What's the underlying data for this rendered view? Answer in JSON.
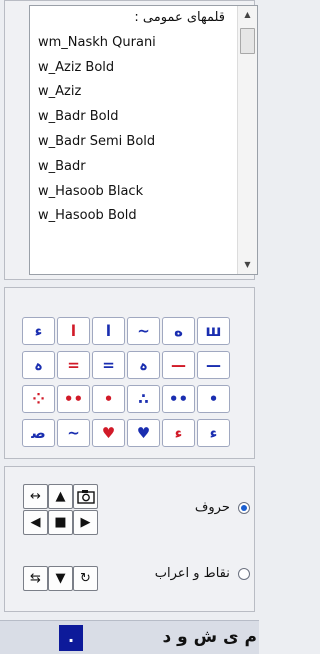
{
  "font_list": {
    "items": [
      "قلمهای عمومی :",
      "wm_Naskh Qurani",
      "w_Aziz Bold",
      "w_Aziz",
      "w_Badr Bold",
      "w_Badr Semi Bold",
      "w_Badr",
      "w_Hasoob Black",
      "w_Hasoob Bold"
    ],
    "scroll_up_icon": "triangle-up",
    "scroll_down_icon": "triangle-down"
  },
  "symbols": [
    {
      "glyph": "ء",
      "color": "#1a2eb0"
    },
    {
      "glyph": "ا",
      "color": "#d11a28"
    },
    {
      "glyph": "ا",
      "color": "#1a2eb0"
    },
    {
      "glyph": "~",
      "color": "#1a2eb0"
    },
    {
      "glyph": "ه",
      "color": "#1a2eb0"
    },
    {
      "glyph": "ш",
      "color": "#1a2eb0"
    },
    {
      "glyph": "ہ",
      "color": "#1a2eb0"
    },
    {
      "glyph": "=",
      "color": "#d11a28"
    },
    {
      "glyph": "=",
      "color": "#1a2eb0"
    },
    {
      "glyph": "ہ",
      "color": "#1a2eb0"
    },
    {
      "glyph": "—",
      "color": "#d11a28"
    },
    {
      "glyph": "—",
      "color": "#1a2eb0"
    },
    {
      "glyph": "⁘",
      "color": "#d11a28"
    },
    {
      "glyph": "••",
      "color": "#d11a28"
    },
    {
      "glyph": "•",
      "color": "#d11a28"
    },
    {
      "glyph": "∴",
      "color": "#1a2eb0"
    },
    {
      "glyph": "••",
      "color": "#1a2eb0"
    },
    {
      "glyph": "•",
      "color": "#1a2eb0"
    },
    {
      "glyph": "ﺻ",
      "color": "#1a2eb0"
    },
    {
      "glyph": "~",
      "color": "#1a2eb0"
    },
    {
      "glyph": "♥",
      "color": "#d11a28"
    },
    {
      "glyph": "♥",
      "color": "#1a2eb0"
    },
    {
      "glyph": "ء",
      "color": "#d11a28"
    },
    {
      "glyph": "ء",
      "color": "#1a2eb0"
    }
  ],
  "controls": {
    "radio_letters": "حروف",
    "radio_diacritics": "نقاط و اعراب",
    "selected": "letters",
    "icons": [
      "swap-horizontal-icon",
      "arrow-up-icon",
      "camera-icon",
      "arrow-left-icon",
      "stop-icon",
      "arrow-right-icon",
      "swap-rows-icon",
      "arrow-down-icon",
      "rotate-icon"
    ]
  },
  "letter_bar": {
    "letters": "م ى ش و د",
    "current": "."
  }
}
